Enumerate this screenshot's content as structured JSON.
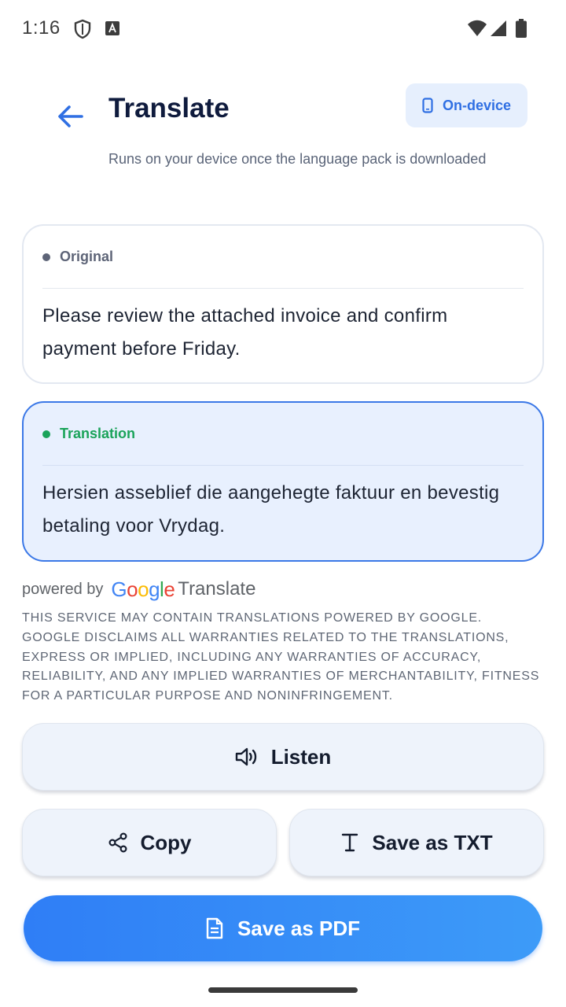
{
  "status_bar": {
    "time": "1:16",
    "icons": [
      "shield-icon",
      "keyboard-a-icon",
      "wifi-icon",
      "signal-icon",
      "battery-icon"
    ]
  },
  "header": {
    "title": "Translate",
    "back_icon": "arrow-left-icon",
    "mode_chip": {
      "label": "On-device",
      "icon": "phone-icon"
    },
    "subtitle": "Runs on your device once the language pack is downloaded"
  },
  "original_card": {
    "label": "Original",
    "text": "Please review the attached invoice and confirm payment before Friday."
  },
  "translation_card": {
    "label": "Translation",
    "text": "Hersien asseblief die aangehegte faktuur en bevestig betaling voor Vrydag."
  },
  "attribution": {
    "powered_by": "powered by",
    "logo_text": "Google",
    "product": "Translate",
    "disclaimer": "THIS SERVICE MAY CONTAIN TRANSLATIONS POWERED BY GOOGLE. GOOGLE DISCLAIMS ALL WARRANTIES RELATED TO THE TRANSLATIONS, EXPRESS OR IMPLIED, INCLUDING ANY WARRANTIES OF ACCURACY, RELIABILITY, AND ANY IMPLIED WARRANTIES OF MERCHANTABILITY, FITNESS FOR A PARTICULAR PURPOSE AND NONINFRINGEMENT."
  },
  "actions": {
    "listen": "Listen",
    "copy": "Copy",
    "save_txt": "Save as TXT",
    "save_pdf": "Save as PDF"
  },
  "colors": {
    "accent": "#2f6fe3",
    "translation_border": "#3b78e7",
    "translation_bg": "#e8f0fe",
    "success_dot": "#1aa35a",
    "primary_button": "#2f7ef6"
  }
}
